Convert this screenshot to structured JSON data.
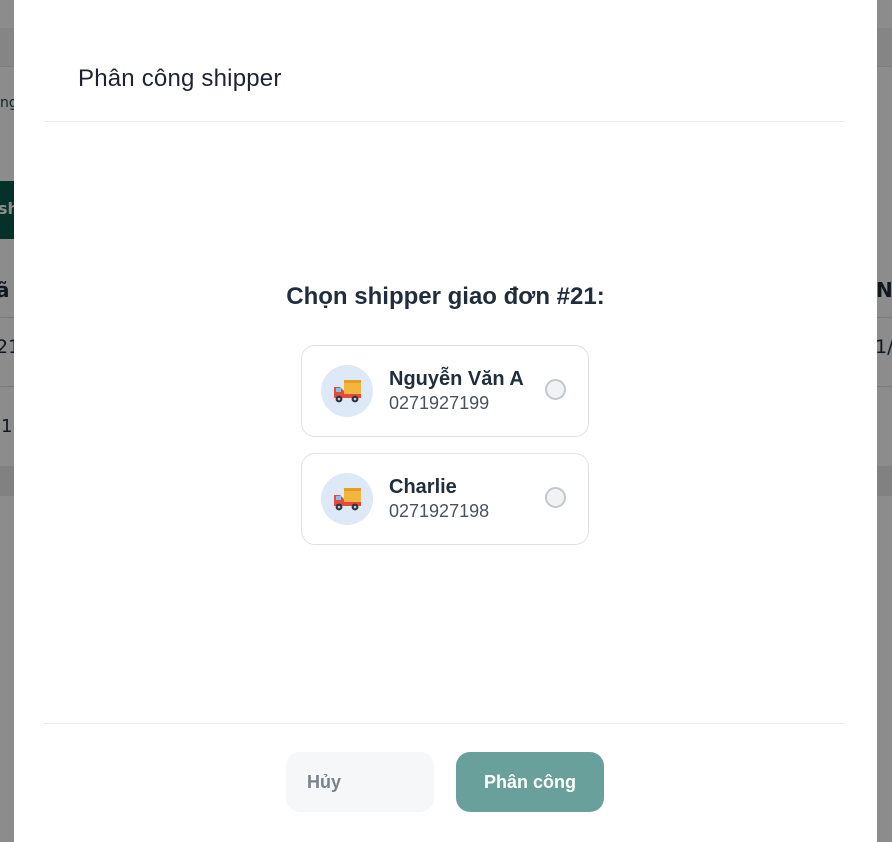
{
  "background": {
    "fragment_top": "ng",
    "fragment_button": "sh",
    "fragment_header_left": "ã",
    "fragment_header_right": "N",
    "fragment_row1_left": "21",
    "fragment_row1_right": "1/",
    "fragment_row2_left": "1"
  },
  "modal": {
    "title": "Phân công shipper",
    "prompt": "Chọn shipper giao đơn #21:",
    "shippers": [
      {
        "name": "Nguyễn Văn A",
        "phone": "0271927199",
        "icon": "delivery-truck-icon",
        "selected": false
      },
      {
        "name": "Charlie",
        "phone": "0271927198",
        "icon": "delivery-truck-icon",
        "selected": false
      }
    ],
    "cancel_label": "Hủy",
    "assign_label": "Phân công"
  },
  "colors": {
    "primary_button": "#6aa09b",
    "background_button": "#0b5a4c",
    "avatar_bg": "#dde9f7"
  }
}
